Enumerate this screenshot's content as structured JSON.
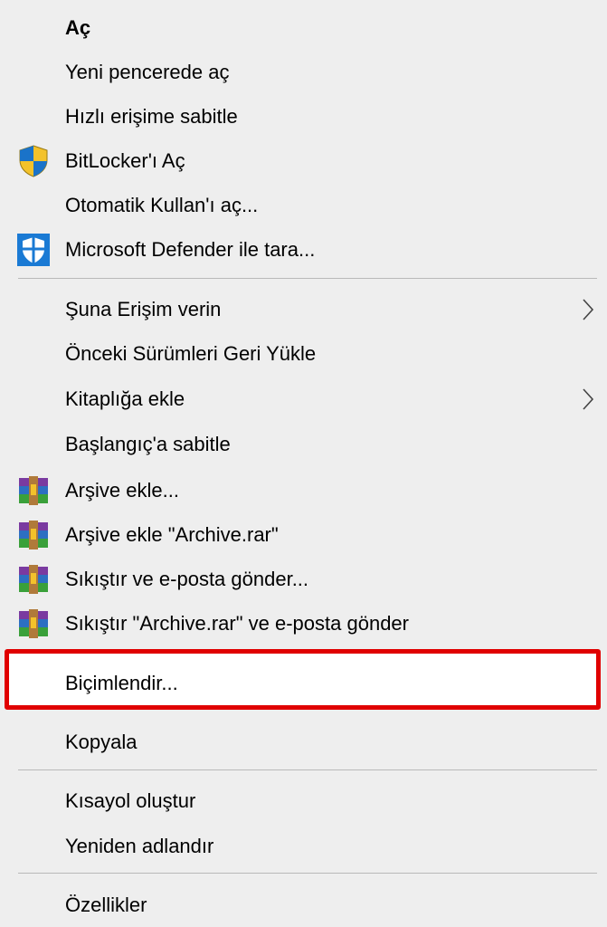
{
  "menu": {
    "items": [
      {
        "label": "Aç"
      },
      {
        "label": "Yeni pencerede aç"
      },
      {
        "label": "Hızlı erişime sabitle"
      },
      {
        "label": "BitLocker'ı Aç",
        "icon": "bitlocker-shield-icon"
      },
      {
        "label": "Otomatik Kullan'ı aç..."
      },
      {
        "label": "Microsoft Defender ile tara...",
        "icon": "defender-shield-icon"
      },
      {
        "label": "Şuna Erişim verin",
        "submenu": true
      },
      {
        "label": "Önceki Sürümleri Geri Yükle"
      },
      {
        "label": "Kitaplığa ekle",
        "submenu": true
      },
      {
        "label": "Başlangıç'a sabitle"
      },
      {
        "label": "Arşive ekle...",
        "icon": "winrar-icon"
      },
      {
        "label": "Arşive ekle \"Archive.rar\"",
        "icon": "winrar-icon"
      },
      {
        "label": "Sıkıştır ve e-posta gönder...",
        "icon": "winrar-icon"
      },
      {
        "label": "Sıkıştır \"Archive.rar\" ve e-posta gönder",
        "icon": "winrar-icon"
      },
      {
        "label": "Biçimlendir...",
        "highlighted": true
      },
      {
        "label": "Kopyala"
      },
      {
        "label": "Kısayol oluştur"
      },
      {
        "label": "Yeniden adlandır"
      },
      {
        "label": "Özellikler"
      }
    ]
  },
  "colors": {
    "menu_background": "#eeeeee",
    "separator": "#b9b9b9",
    "highlight_border": "#e00000",
    "bitlocker_shield_blue": "#1a73c9",
    "bitlocker_shield_yellow": "#f3c22b",
    "defender_blue": "#1a7ad4"
  }
}
